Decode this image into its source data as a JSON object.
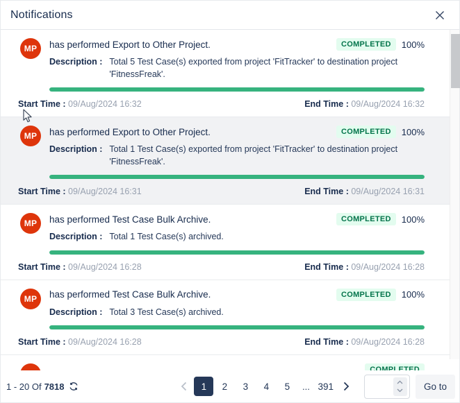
{
  "header": {
    "title": "Notifications"
  },
  "notifications": [
    {
      "avatar": "MP",
      "action": "has performed Export to Other Project.",
      "status": "COMPLETED",
      "percent": "100%",
      "description_label": "Description :",
      "description": "Total 5 Test Case(s) exported from project 'FitTracker' to destination project 'FitnessFreak'.",
      "start_label": "Start Time :",
      "start_time": "09/Aug/2024 16:32",
      "end_label": "End Time :",
      "end_time": "09/Aug/2024 16:32"
    },
    {
      "avatar": "MP",
      "action": "has performed Export to Other Project.",
      "status": "COMPLETED",
      "percent": "100%",
      "description_label": "Description :",
      "description": "Total 1 Test Case(s) exported from project 'FitTracker' to destination project 'FitnessFreak'.",
      "start_label": "Start Time :",
      "start_time": "09/Aug/2024 16:31",
      "end_label": "End Time :",
      "end_time": "09/Aug/2024 16:31"
    },
    {
      "avatar": "MP",
      "action": "has performed Test Case Bulk Archive.",
      "status": "COMPLETED",
      "percent": "100%",
      "description_label": "Description :",
      "description": "Total 1 Test Case(s) archived.",
      "start_label": "Start Time :",
      "start_time": "09/Aug/2024 16:28",
      "end_label": "End Time :",
      "end_time": "09/Aug/2024 16:28"
    },
    {
      "avatar": "MP",
      "action": "has performed Test Case Bulk Archive.",
      "status": "COMPLETED",
      "percent": "100%",
      "description_label": "Description :",
      "description": "Total 3 Test Case(s) archived.",
      "start_label": "Start Time :",
      "start_time": "09/Aug/2024 16:28",
      "end_label": "End Time :",
      "end_time": "09/Aug/2024 16:28"
    }
  ],
  "partial_item": {
    "avatar": "MP",
    "status": "COMPLETED"
  },
  "footer": {
    "range_label": "1 - 20 Of",
    "total": "7818",
    "pages": [
      "1",
      "2",
      "3",
      "4",
      "5",
      "...",
      "391"
    ],
    "active_page": "1",
    "goto_input_value": "",
    "goto_label": "Go to"
  },
  "colors": {
    "text_primary": "#172b4d",
    "text_secondary": "#98a1b0",
    "avatar_bg": "#de350b",
    "badge_bg": "#e3fcef",
    "badge_text": "#04744b",
    "progress_green": "#36b37e",
    "active_page_bg": "#253858",
    "highlight_row_bg": "#f1f2f4"
  }
}
